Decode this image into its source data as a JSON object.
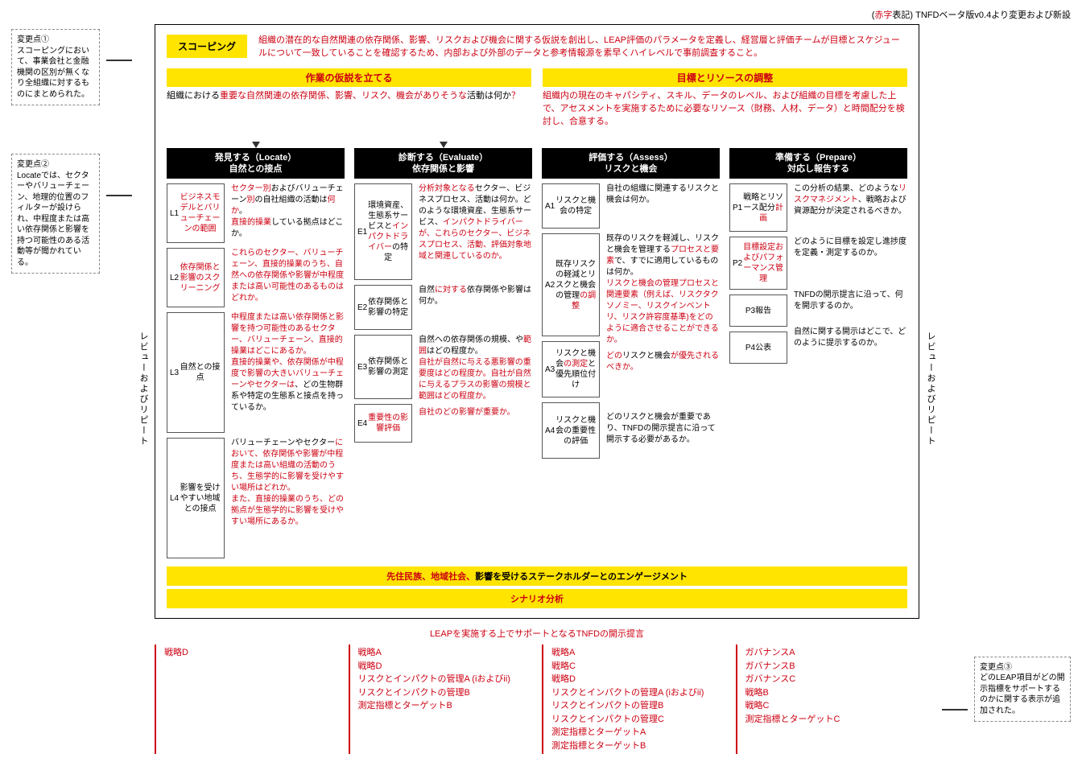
{
  "header_note_pre": "(",
  "header_note_red": "赤字",
  "header_note_post": "表記) TNFDベータ版v0.4より変更および新設",
  "callouts": {
    "cp1": {
      "title": "変更点①",
      "text": "スコーピングにおいて、事業会社と金融機関の区別が無くなり全組織に対するものにまとめられた。"
    },
    "cp2": {
      "title": "変更点②",
      "text": "Locateでは、セクターやバリューチェーン、地理的位置のフィルターが設けられ、中程度または高い依存関係と影響を持つ可能性のある活動等が聞かれている。"
    },
    "cp3": {
      "title": "変更点③",
      "text": "どのLEAP項目がどの開示指標をサポートするのかに関する表示が追加された。"
    }
  },
  "side_label": "レビューおよびリピート",
  "scoping": {
    "label": "スコーピング",
    "desc": "組織の潜在的な自然関連の依存関係、影響、リスクおよび機会に関する仮説を創出し、LEAP評価のパラメータを定義し、経営層と評価チームが目標とスケジュールについて一致していることを確認するため、内部および外部のデータと参考情報源を素早くハイレベルで事前調査すること。"
  },
  "setup": {
    "left_title": "作業の仮説を立てる",
    "left_pre": "組織における",
    "left_red": "重要な自然関連の依存関係、影響、リスク、機会がありそうな",
    "left_post": "活動は何か",
    "left_q": "？",
    "right_title": "目標とリソースの調整",
    "right_text": "組織内の現在のキャパシティ、スキル、データのレベル、および組織の目標を考慮した上で、アセスメントを実施するために必要なリソース（財務、人材、データ）と時間配分を検討し、合意する。"
  },
  "columns": {
    "locate": {
      "head": "発見する（Locate）\n自然との接点",
      "items": [
        {
          "code": "L1",
          "label": "ビジネスモデルとバリューチェーンの範囲",
          "red": true,
          "desc": [
            {
              "t": "セクター別",
              "r": true
            },
            {
              "t": "および"
            },
            {
              "t": "バリューチェーン",
              "r": false
            },
            {
              "t": "別",
              "r": true
            },
            {
              "t": "の自社組織の活動は"
            },
            {
              "t": "何か",
              "r": true
            },
            {
              "t": "。"
            },
            {
              "br": true
            },
            {
              "t": "直接的操業",
              "r": true
            },
            {
              "t": "している拠点はどこか。"
            }
          ]
        },
        {
          "code": "L2",
          "label": "依存関係と影響のスクリーニング",
          "red": true,
          "desc": [
            {
              "t": "これらのセクター、バリューチェーン、直接的操業のうち、自然への依存関係や影響が中程度または高い可能性のあるものはどれか。",
              "r": true
            }
          ]
        },
        {
          "code": "L3",
          "label": "自然との接点",
          "desc": [
            {
              "t": "中程度または高い依存関係と影響を持つ可能性のあるセクター、バリューチェーン、直接的操業はどこにあるか。",
              "r": true
            },
            {
              "br": true
            },
            {
              "t": "直接的操業や、依存関係が中程度で影響の大きいバリューチェーンやセクターは",
              "r": true
            },
            {
              "t": "、どの生物群系や特定の生態系と接点を持っているか。"
            }
          ]
        },
        {
          "code": "L4",
          "label": "影響を受けやすい地域との接点",
          "desc": [
            {
              "t": "バリューチェーンやセクター"
            },
            {
              "t": "において、依存関係や影響が中程度または高い組織の活動のうち、生態学的に影響を受けやすい場所はどれか。",
              "r": true
            },
            {
              "br": true
            },
            {
              "t": "また、直接的操業のうち、どの拠点が生態学的に影響を受けやすい場所にあるか。",
              "r": true
            }
          ]
        }
      ]
    },
    "evaluate": {
      "head": "診断する（Evaluate）\n依存関係と影響",
      "items": [
        {
          "code": "E1",
          "label": "環境資産、生態系サービスとインパクトドライバーの特定",
          "red_parts": [
            "インパクトドライバー"
          ],
          "desc": [
            {
              "t": "分析対象となる",
              "r": true
            },
            {
              "t": "セクター、ビジネスプロセス、活動は何か。どのような環境資産、生態系サービス、"
            },
            {
              "t": "インパクトドライバーが、これらのセクター、ビジネスプロセス、活動、評価対象地域と関連しているのか。",
              "r": true
            }
          ]
        },
        {
          "code": "E2",
          "label": "依存関係と影響の特定",
          "desc": [
            {
              "t": "自然"
            },
            {
              "t": "に対する",
              "r": true
            },
            {
              "t": "依存関係や影響は何か。"
            }
          ]
        },
        {
          "code": "E3",
          "label": "依存関係と影響の測定",
          "desc": [
            {
              "t": "自然への依存関係の規模、や"
            },
            {
              "t": "範囲",
              "r": true
            },
            {
              "t": "はどの程度か。"
            },
            {
              "br": true
            },
            {
              "t": "自社が自然に与える悪影響の重要度はどの程度か。自社が自然に与えるプラスの影響の規模と範囲はどの程度か。",
              "r": true
            }
          ]
        },
        {
          "code": "E4",
          "label": "重要性の影響評価",
          "red": true,
          "desc": [
            {
              "t": "自社のどの影響が重要か。",
              "r": true
            }
          ]
        }
      ]
    },
    "assess": {
      "head": "評価する（Assess）\nリスクと機会",
      "items": [
        {
          "code": "A1",
          "label": "リスクと機会の特定",
          "desc": [
            {
              "t": "自社の組織に関連するリスクと機会は何か。"
            }
          ]
        },
        {
          "code": "A2",
          "label": "既存リスクの軽減とリスクと機会の管理の調整",
          "red_parts": [
            "の調整"
          ],
          "desc": [
            {
              "t": "既存のリスクを軽減し、リスクと機会を管理する"
            },
            {
              "t": "プロセスと要素",
              "r": true
            },
            {
              "t": "で、すでに適用しているものは何か。"
            },
            {
              "br": true
            },
            {
              "t": "リスクと機会の管理プロセスと関連要素（例えば、リスクタクソノミー、リスクインベントリ、リスク許容度基準)をどのように適合させることができるか。",
              "r": true
            }
          ]
        },
        {
          "code": "A3",
          "label": "リスクと機会の測定と優先順位付け",
          "red_parts": [
            "の測定"
          ],
          "desc": [
            {
              "t": "どの",
              "r": true
            },
            {
              "t": "リスクと機会"
            },
            {
              "t": "が優先されるべきか。",
              "r": true
            }
          ]
        },
        {
          "code": "A4",
          "label": "リスクと機会の重要性の評価",
          "desc": [
            {
              "t": "どのリスクと機会が重要であり、TNFDの開示提言に沿って開示する必要があるか。"
            }
          ]
        }
      ]
    },
    "prepare": {
      "head": "準備する（Prepare）\n対応し報告する",
      "items": [
        {
          "code": "P1",
          "label": "戦略とリソース配分計画",
          "red_parts": [
            "計画"
          ],
          "desc": [
            {
              "t": "この分析の結果、どのような"
            },
            {
              "t": "リスクマネジメント",
              "r": true
            },
            {
              "t": "、戦略および資源配分が決定されるべきか。"
            }
          ]
        },
        {
          "code": "P2",
          "label": "目標設定およびパフォーマンス管理",
          "red": true,
          "desc": [
            {
              "t": "どのように目標を設定し進捗度を定義・測定するのか。"
            }
          ]
        },
        {
          "code": "P3",
          "label": "報告",
          "desc": [
            {
              "t": "TNFDの開示提言に沿って、何を開示するのか。"
            }
          ]
        },
        {
          "code": "P4",
          "label": "公表",
          "desc": [
            {
              "t": "自然に関する開示はどこで、どのように提示するのか。"
            }
          ]
        }
      ]
    }
  },
  "bottom_bar1_red": "先住民族、地域社会、",
  "bottom_bar1": "影響を受けるステークホルダーとのエンゲージメント",
  "bottom_bar2": "シナリオ分析",
  "disclosure_title": "LEAPを実施する上でサポートとなるTNFDの開示提言",
  "disclosure": {
    "c1": [
      "戦略D"
    ],
    "c2": [
      "戦略A",
      "戦略D",
      "リスクとインパクトの管理A (iおよびii)",
      "リスクとインパクトの管理B",
      "測定指標とターゲットB"
    ],
    "c3": [
      "戦略A",
      "戦略C",
      "戦略D",
      "リスクとインパクトの管理A (iおよびii)",
      "リスクとインパクトの管理B",
      "リスクとインパクトの管理C",
      "測定指標とターゲットA",
      "測定指標とターゲットB"
    ],
    "c4": [
      "ガバナンスA",
      "ガバナンスB",
      "ガバナンスC",
      "戦略B",
      "戦略C",
      "測定指標とターゲットC"
    ]
  }
}
